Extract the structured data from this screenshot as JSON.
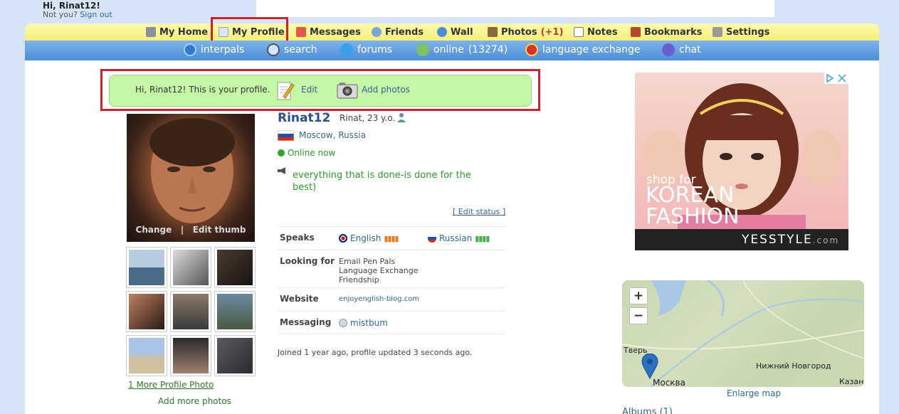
{
  "header": {
    "greeting": "Hi, Rinat12!",
    "not_you": "Not you?",
    "sign_out": "Sign out"
  },
  "nav": {
    "my_home": "My Home",
    "my_profile": "My Profile",
    "messages": "Messages",
    "friends": "Friends",
    "wall": "Wall",
    "photos": "Photos",
    "photos_count": "(+1)",
    "notes": "Notes",
    "bookmarks": "Bookmarks",
    "settings": "Settings"
  },
  "subnav": {
    "interpals": "interpals",
    "search": "search",
    "forums": "forums",
    "online": "online",
    "online_count": "(13274)",
    "language_exchange": "language exchange",
    "chat": "chat"
  },
  "banner": {
    "text": "Hi, Rinat12!  This is your profile.",
    "edit": "Edit",
    "add_photos": "Add photos"
  },
  "photo": {
    "change": "Change",
    "separator": "|",
    "edit_thumb": "Edit thumb",
    "more_photo": "1 More Profile Photo",
    "add_more": "Add more photos"
  },
  "profile": {
    "username": "Rinat12",
    "subinfo": "Rinat, 23 y.o.",
    "city": "Moscow",
    "country": "Russia",
    "online": "Online now",
    "status": "everything that is done-is done for the best)",
    "edit_status": "[ Edit status ]",
    "speaks_label": "Speaks",
    "lang1": "English",
    "lang2": "Russian",
    "looking_label": "Looking for",
    "looking1": "Email Pen Pals",
    "looking2": "Language Exchange",
    "looking3": "Friendship",
    "website_label": "Website",
    "website": "enjoyenglish-blog.com",
    "messaging_label": "Messaging",
    "messaging": "mistbum",
    "joined": "Joined 1 year ago, profile updated 3 seconds ago."
  },
  "ad": {
    "shop_for": "shop for",
    "line2": "KOREAN",
    "line3": "FASHION",
    "brand": "YESSTYLE",
    "brand_com": ".com"
  },
  "map": {
    "zoom_in": "+",
    "zoom_out": "−",
    "city1": "Тверь",
    "city2": "Нижний Новгород",
    "city3": "Москва",
    "city4": "Казан",
    "enlarge": "Enlarge map"
  },
  "albums": "Albums (1)",
  "colors": {
    "nav_yellow": "#f5ef7a",
    "nav_blue": "#4c8ed6",
    "banner_green": "#c4f7a6",
    "highlight_red": "#c8232c",
    "link_blue": "#336699",
    "online_green": "#2a9a2a"
  }
}
